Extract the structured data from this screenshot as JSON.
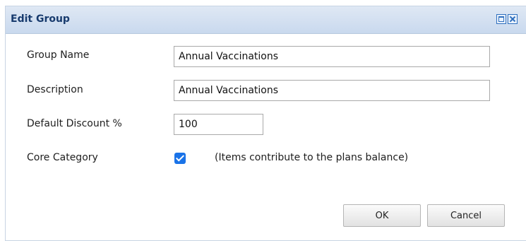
{
  "dialog": {
    "title": "Edit Group",
    "controls": {
      "maximize_icon": "maximize-icon",
      "close_icon": "close-icon"
    }
  },
  "form": {
    "group_name": {
      "label": "Group Name",
      "value": "Annual Vaccinations"
    },
    "description": {
      "label": "Description",
      "value": "Annual Vaccinations"
    },
    "default_discount": {
      "label": "Default Discount %",
      "value": "100"
    },
    "core_category": {
      "label": "Core Category",
      "checked": true,
      "hint": "(Items contribute to the plans balance)"
    }
  },
  "buttons": {
    "ok": "OK",
    "cancel": "Cancel"
  },
  "colors": {
    "title_text": "#183b6e",
    "titlebar_bg": "#d4e1f1",
    "checkbox": "#1a73e8"
  }
}
